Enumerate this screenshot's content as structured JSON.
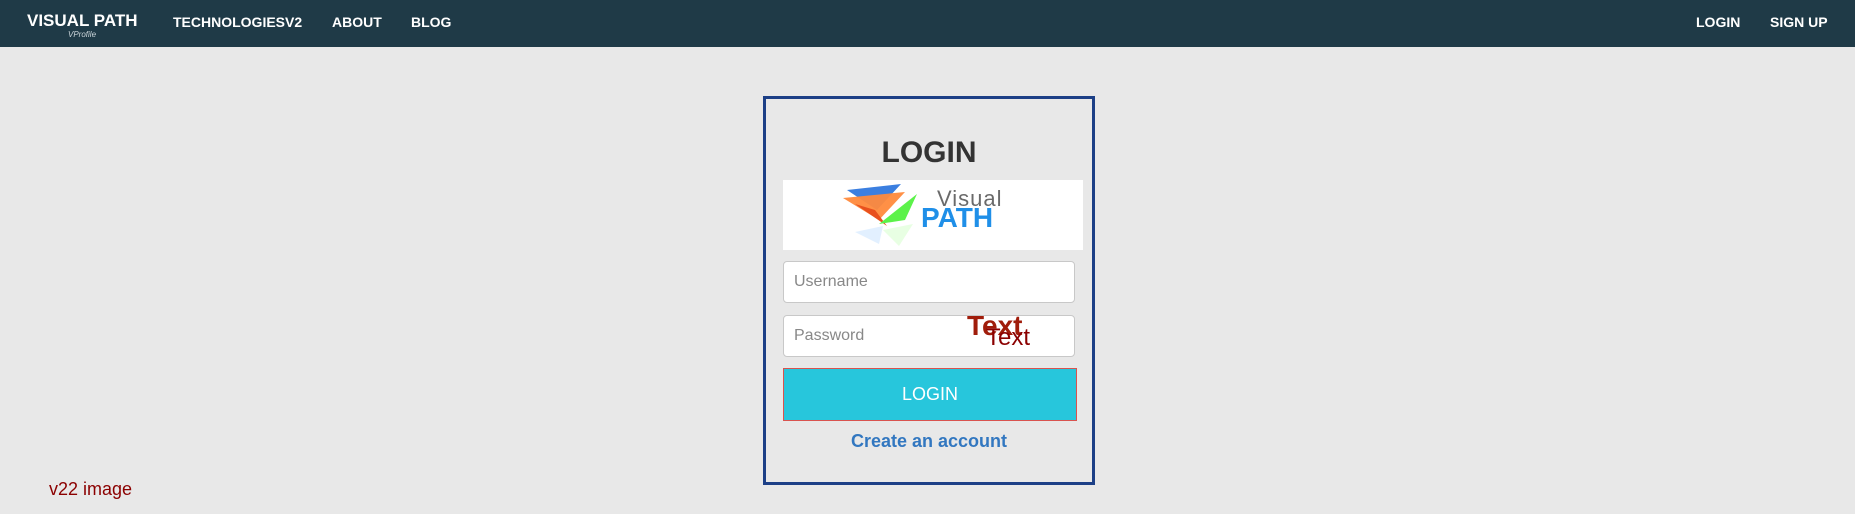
{
  "navbar": {
    "brand_title": "VISUAL PATH",
    "brand_subtitle": "VProfile",
    "links": [
      {
        "label": "TECHNOLOGIESV2"
      },
      {
        "label": "ABOUT"
      },
      {
        "label": "BLOG"
      }
    ],
    "right_links": [
      {
        "label": "LOGIN"
      },
      {
        "label": "SIGN UP"
      }
    ],
    "background_color": "#1f3a47"
  },
  "login": {
    "heading": "LOGIN",
    "logo": {
      "word1": "Visual",
      "word2": "PATH",
      "icon": "visual-path-logo"
    },
    "username_placeholder": "Username",
    "username_value": "",
    "password_placeholder": "Password",
    "password_value": "",
    "submit_label": "LOGIN",
    "create_account_label": "Create an account",
    "border_color": "#1c3f86",
    "button_color": "#27c6dc"
  },
  "overlay": {
    "text_big": "Text",
    "text_small": "Text"
  },
  "footer": {
    "note": "v22 image"
  }
}
